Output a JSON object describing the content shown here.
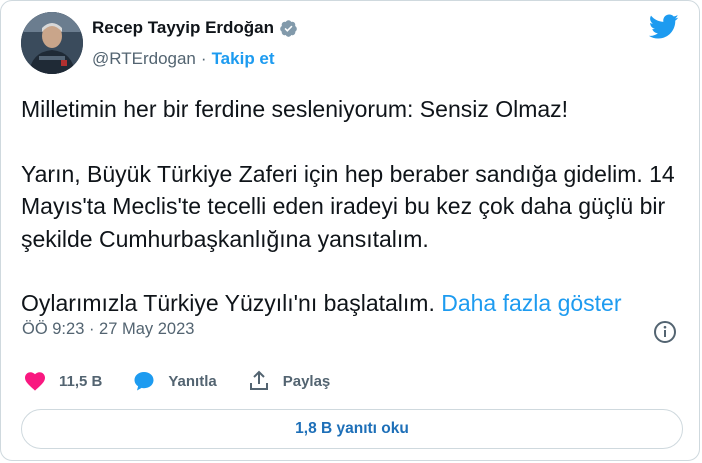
{
  "author": {
    "display_name": "Recep Tayyip Erdoğan",
    "handle": "@RTErdogan",
    "separator": "·",
    "follow_label": "Takip et",
    "verified_icon": "verified-badge-icon"
  },
  "tweet": {
    "paragraphs": [
      "Milletimin her bir ferdine sesleniyorum: Sensiz Olmaz!",
      "Yarın, Büyük Türkiye Zaferi için hep beraber sandığa gidelim. 14 Mayıs'ta Meclis'te tecelli eden iradeyi bu kez çok daha güçlü bir şekilde Cumhurbaşkanlığına yansıtalım.",
      "Oylarımızla Türkiye Yüzyılı'nı başlatalım."
    ],
    "show_more_label": "Daha fazla göster",
    "timestamp": "ÖÖ 9:23 · 27 May 2023"
  },
  "actions": {
    "like_count": "11,5 B",
    "reply_label": "Yanıtla",
    "share_label": "Paylaş"
  },
  "replies_button_label": "1,8 B yanıtı oku",
  "colors": {
    "accent": "#1d9bf0",
    "like": "#f91880",
    "text": "#0f1419",
    "muted": "#536471"
  }
}
